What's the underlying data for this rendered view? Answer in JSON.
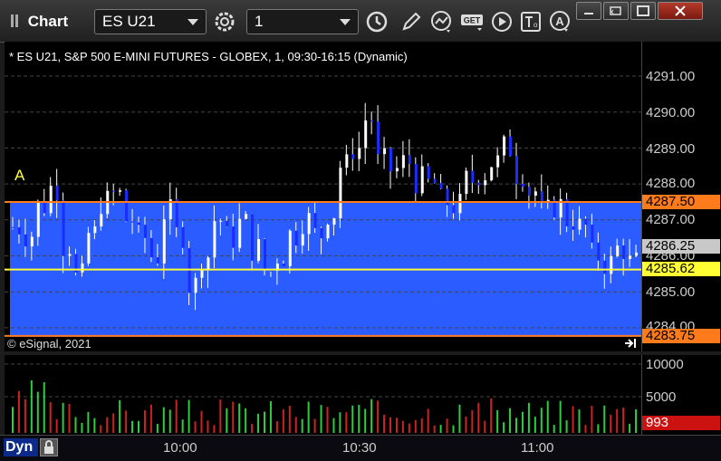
{
  "window": {
    "title": "Chart",
    "symbol": "ES U21",
    "interval": "1"
  },
  "chart": {
    "header": "* ES U21, S&P 500 E-MINI FUTURES - GLOBEX, 1, 09:30-16:15 (Dynamic)",
    "copyright": "© eSignal, 2021",
    "marker": "A",
    "price_labels": [
      "4291.00",
      "4290.00",
      "4289.00",
      "4288.00",
      "4287.00",
      "4286.00",
      "4285.00",
      "4284.00"
    ],
    "tags": {
      "upper_zone": "4287.50",
      "last": "4286.25",
      "line": "4285.62",
      "lower_zone": "4283.75"
    },
    "colors": {
      "zone": "#2b5cff",
      "orange": "#ff7a1a",
      "yellow": "#ffff33",
      "up": "#ffffff",
      "down": "#1a2cff"
    }
  },
  "volume": {
    "labels": [
      "10000",
      "5000"
    ],
    "tag": "993",
    "colors": {
      "up": "#2ecc40",
      "down": "#cc2222",
      "tag": "#cc1111"
    }
  },
  "time_axis": {
    "labels": [
      "10:00",
      "10:30",
      "11:00"
    ]
  },
  "footer": {
    "dyn_label": "Dyn"
  }
}
